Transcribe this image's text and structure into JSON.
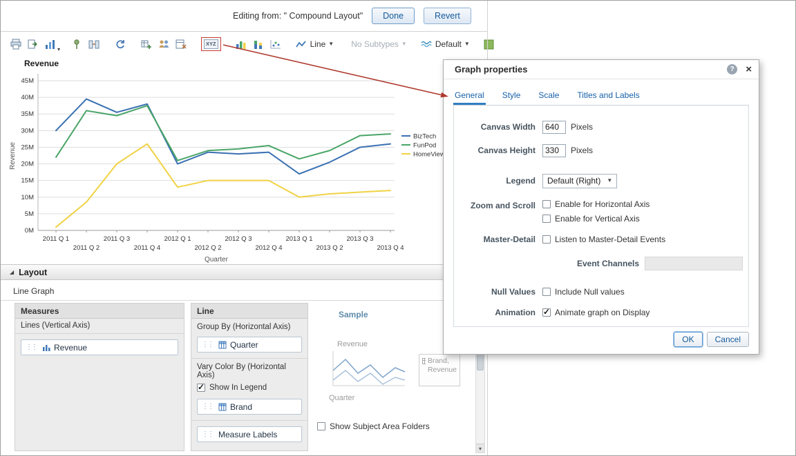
{
  "colors": {
    "highlight_red": "#c23b2e",
    "accent_blue": "#1761a8"
  },
  "header": {
    "editing_from": "Editing from: \" Compound Layout\"",
    "done_label": "Done",
    "revert_label": "Revert"
  },
  "toolbar": {
    "xyz_label": "XYZ",
    "graph_type_label": "Line",
    "subtype_label": "No Subtypes",
    "style_label": "Default"
  },
  "chart_data": {
    "type": "line",
    "title": "Revenue",
    "ylabel": "Revenue",
    "xlabel": "Quarter",
    "ylim": [
      0,
      45
    ],
    "ytick_step": 5,
    "ytick_suffix": "M",
    "grid": true,
    "legend_position": "right",
    "categories": [
      "2011 Q 1",
      "2011 Q 2",
      "2011 Q 3",
      "2011 Q 4",
      "2012 Q 1",
      "2012 Q 2",
      "2012 Q 3",
      "2012 Q 4",
      "2013 Q 1",
      "2013 Q 2",
      "2013 Q 3",
      "2013 Q 4"
    ],
    "series": [
      {
        "name": "BizTech",
        "color": "#3a70b2",
        "values": [
          30,
          39.5,
          35.5,
          38,
          20,
          23.5,
          23,
          23.5,
          17,
          20.5,
          25,
          26
        ]
      },
      {
        "name": "FunPod",
        "color": "#49a567",
        "values": [
          22,
          36,
          34.5,
          37.5,
          21,
          24,
          24.5,
          25.5,
          21.5,
          24,
          28.5,
          29
        ]
      },
      {
        "name": "HomeView",
        "color": "#f0d245",
        "values": [
          1,
          8.5,
          20,
          26,
          13,
          15,
          15,
          15,
          10,
          11,
          11.5,
          12
        ]
      }
    ]
  },
  "layout": {
    "title": "Layout",
    "subtitle": "Line Graph",
    "measures": {
      "title": "Measures",
      "section_label": "Lines (Vertical Axis)",
      "items": [
        "Revenue"
      ]
    },
    "line": {
      "title": "Line",
      "group_by_label": "Group By (Horizontal Axis)",
      "group_by_item": "Quarter",
      "vary_color_label": "Vary Color By (Horizontal Axis)",
      "show_in_legend_label": "Show In Legend",
      "show_in_legend_checked": true,
      "brand_item": "Brand",
      "measure_labels_item": "Measure Labels"
    },
    "sample": {
      "title": "Sample",
      "y_label": "Revenue",
      "x_label": "Quarter",
      "box_label": "Brand, Revenue"
    },
    "show_subject_area_folders_label": "Show Subject Area Folders",
    "show_subject_area_folders_checked": false
  },
  "dialog": {
    "title": "Graph properties",
    "help_glyph": "?",
    "close_glyph": "×",
    "tabs": [
      "General",
      "Style",
      "Scale",
      "Titles and Labels"
    ],
    "active_tab": "General",
    "canvas_width_label": "Canvas Width",
    "canvas_width_value": "640",
    "canvas_height_label": "Canvas Height",
    "canvas_height_value": "330",
    "pixels_label": "Pixels",
    "legend_label": "Legend",
    "legend_value": "Default (Right)",
    "zoom_label": "Zoom and Scroll",
    "zoom_horizontal_label": "Enable for Horizontal Axis",
    "zoom_horizontal_checked": false,
    "zoom_vertical_label": "Enable for Vertical Axis",
    "zoom_vertical_checked": false,
    "master_detail_label": "Master-Detail",
    "master_detail_option_label": "Listen to Master-Detail Events",
    "master_detail_checked": false,
    "event_channels_label": "Event Channels",
    "event_channels_value": "",
    "null_values_label": "Null Values",
    "null_values_option_label": "Include Null values",
    "null_values_checked": false,
    "animation_label": "Animation",
    "animation_option_label": "Animate graph on Display",
    "animation_checked": true,
    "ok_label": "OK",
    "cancel_label": "Cancel"
  }
}
